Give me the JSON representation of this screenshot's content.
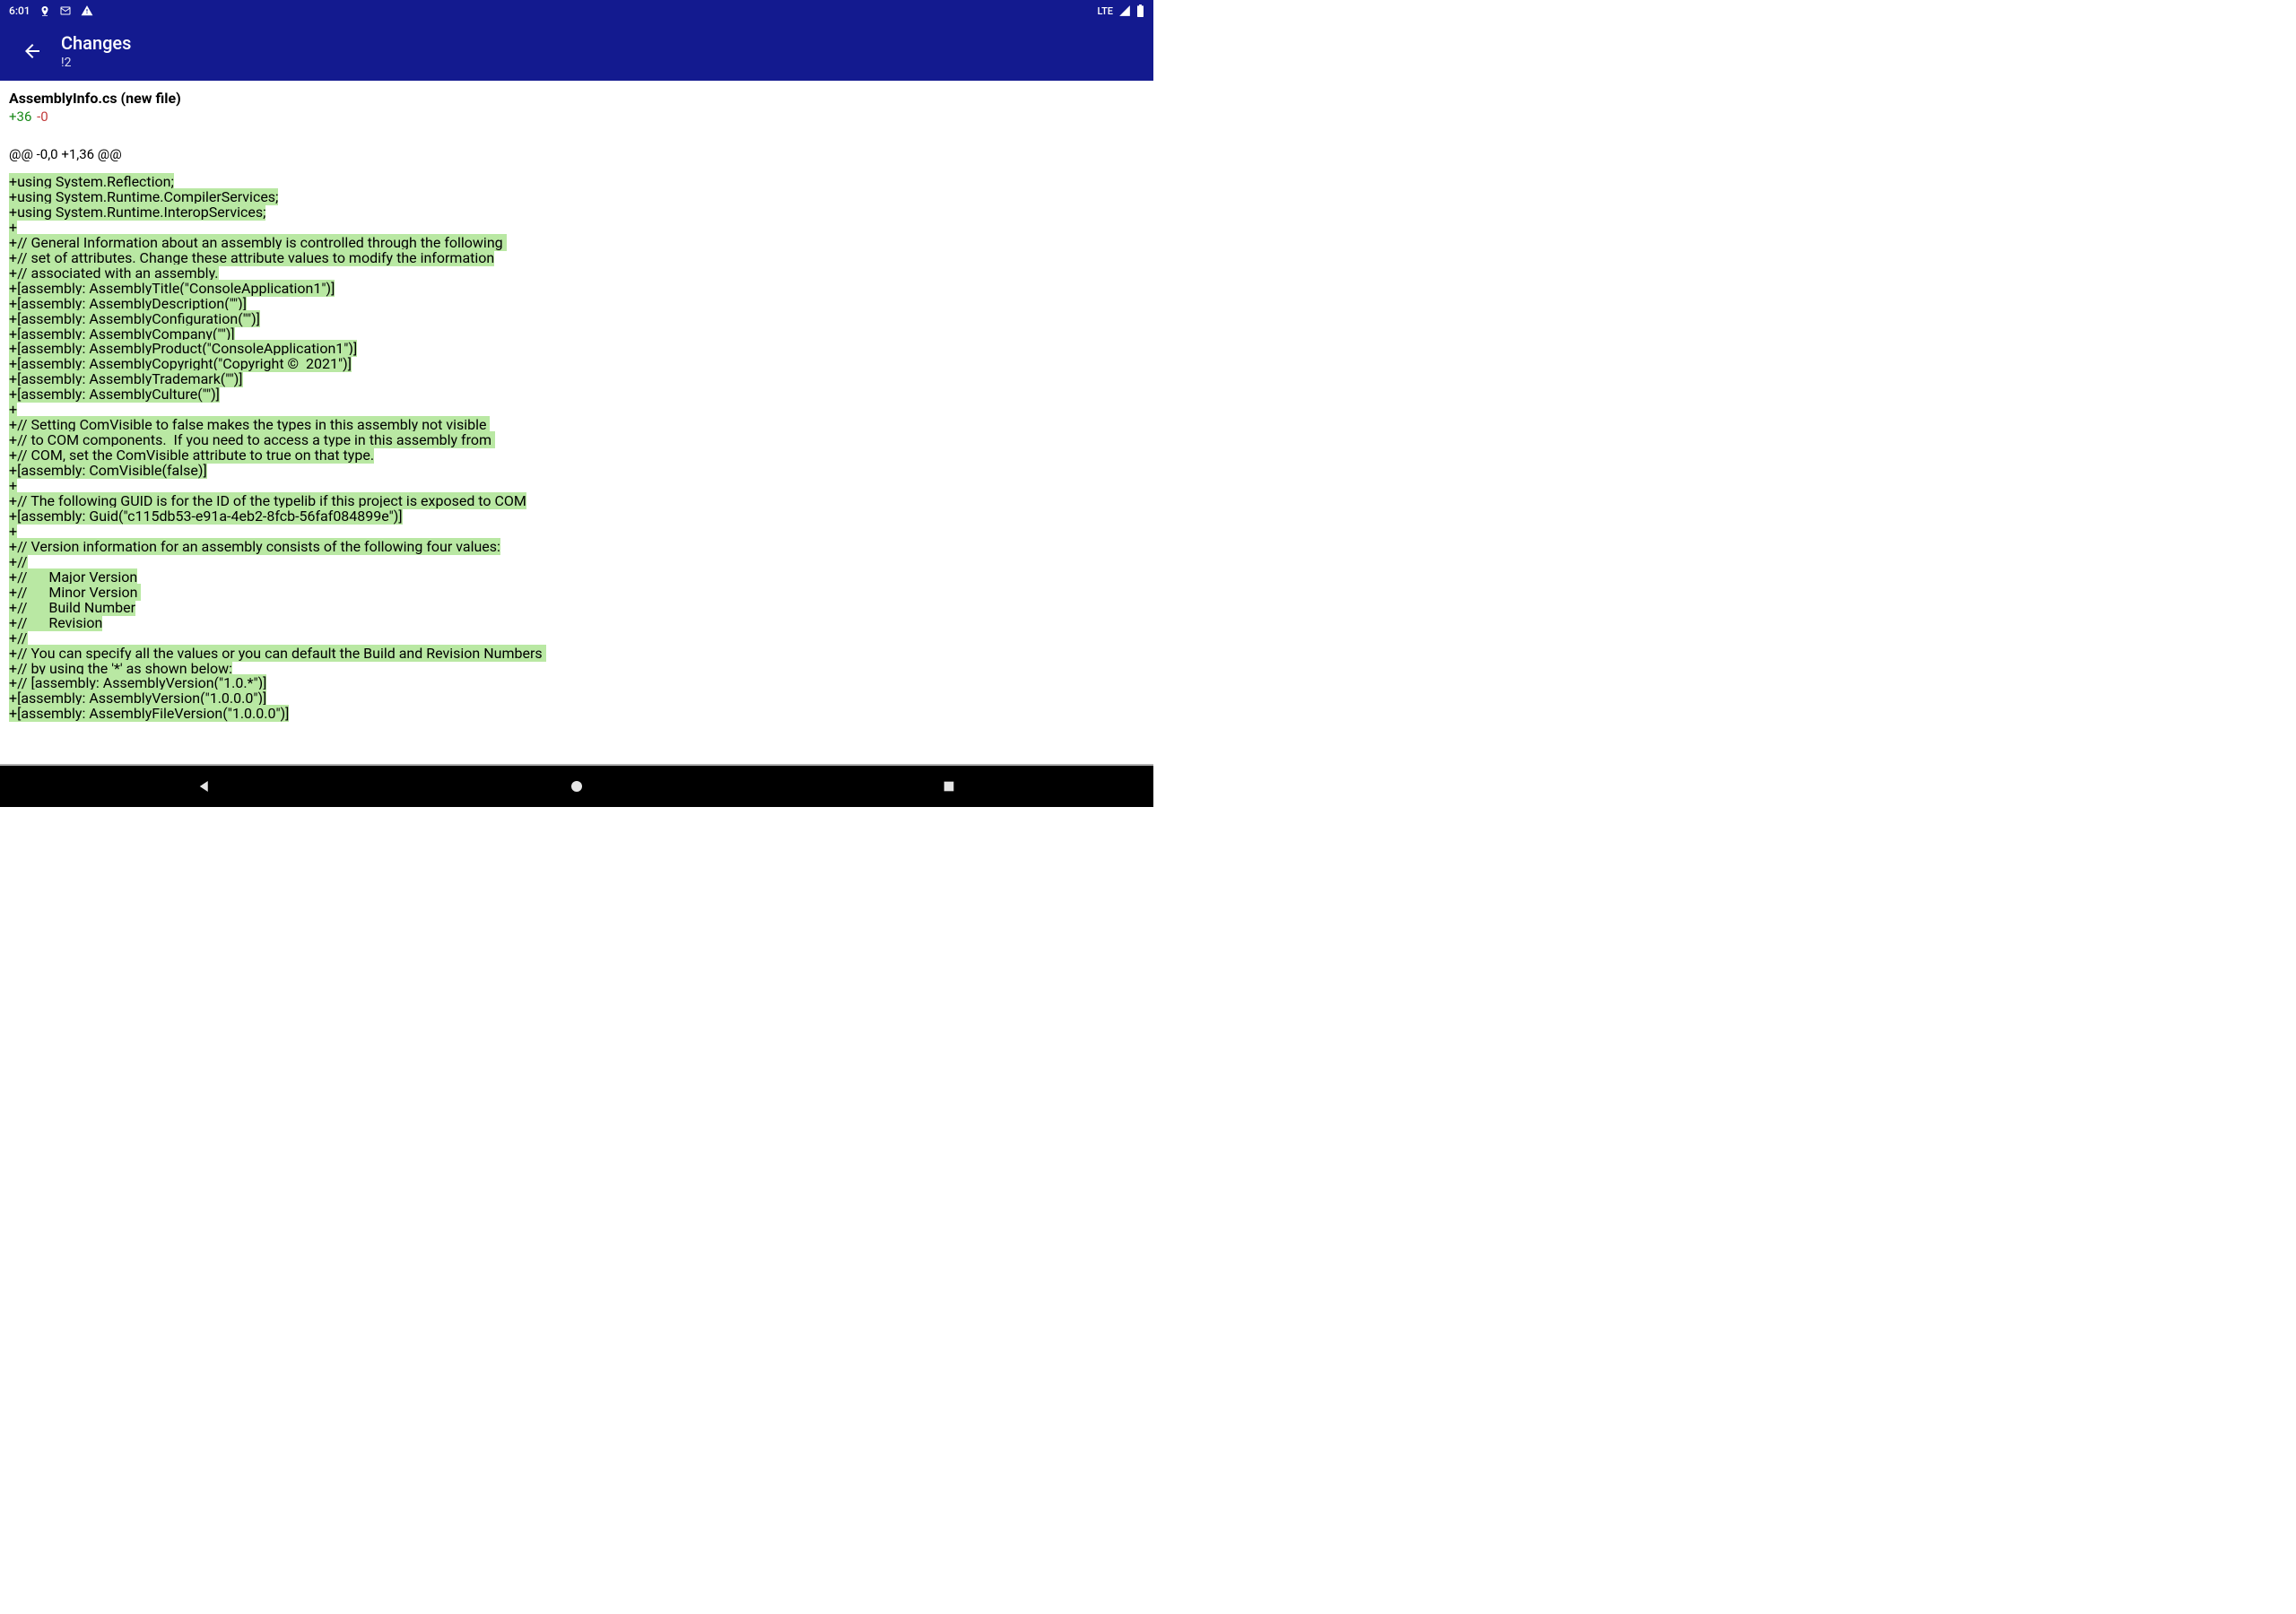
{
  "status_bar": {
    "time": "6:01",
    "network": "LTE"
  },
  "app_bar": {
    "title": "Changes",
    "subtitle": "!2"
  },
  "file": {
    "name_label": "AssemblyInfo.cs (new file)",
    "additions": "+36",
    "deletions": "-0",
    "hunk_header": "@@ -0,0 +1,36 @@"
  },
  "diff_lines": [
    "+using System.Reflection;",
    "+using System.Runtime.CompilerServices;",
    "+using System.Runtime.InteropServices;",
    "+",
    "+// General Information about an assembly is controlled through the following ",
    "+// set of attributes. Change these attribute values to modify the information",
    "+// associated with an assembly.",
    "+[assembly: AssemblyTitle(\"ConsoleApplication1\")]",
    "+[assembly: AssemblyDescription(\"\")]",
    "+[assembly: AssemblyConfiguration(\"\")]",
    "+[assembly: AssemblyCompany(\"\")]",
    "+[assembly: AssemblyProduct(\"ConsoleApplication1\")]",
    "+[assembly: AssemblyCopyright(\"Copyright ©  2021\")]",
    "+[assembly: AssemblyTrademark(\"\")]",
    "+[assembly: AssemblyCulture(\"\")]",
    "+",
    "+// Setting ComVisible to false makes the types in this assembly not visible ",
    "+// to COM components.  If you need to access a type in this assembly from ",
    "+// COM, set the ComVisible attribute to true on that type.",
    "+[assembly: ComVisible(false)]",
    "+",
    "+// The following GUID is for the ID of the typelib if this project is exposed to COM",
    "+[assembly: Guid(\"c115db53-e91a-4eb2-8fcb-56faf084899e\")]",
    "+",
    "+// Version information for an assembly consists of the following four values:",
    "+//",
    "+//      Major Version",
    "+//      Minor Version ",
    "+//      Build Number",
    "+//      Revision",
    "+//",
    "+// You can specify all the values or you can default the Build and Revision Numbers ",
    "+// by using the '*' as shown below:",
    "+// [assembly: AssemblyVersion(\"1.0.*\")]",
    "+[assembly: AssemblyVersion(\"1.0.0.0\")]",
    "+[assembly: AssemblyFileVersion(\"1.0.0.0\")]"
  ]
}
